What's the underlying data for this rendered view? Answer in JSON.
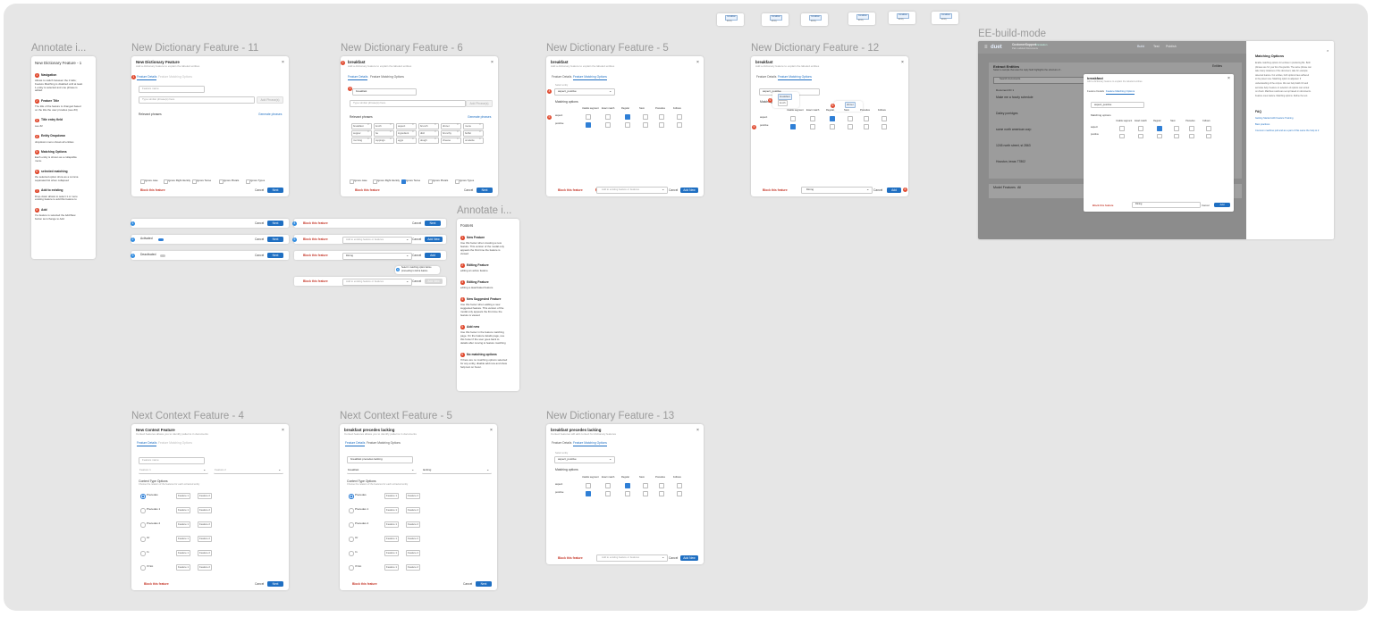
{
  "frame_titles": {
    "annotate1": "Annotate i...",
    "ndf11": "New Dictionary Feature - 11",
    "ndf6": "New Dictionary Feature - 6",
    "ndf5": "New Dictionary Feature - 5",
    "ndf12": "New Dictionary Feature - 12",
    "ee": "EE-build-mode",
    "annotate2": "Annotate i...",
    "ncf4": "Next Context Feature - 4",
    "ncf5": "Next Context Feature - 5",
    "ndf13": "New Dictionary Feature - 13"
  },
  "annotate1": {
    "heading": "New Dictionary Feature - 1",
    "items": [
      {
        "num": "1",
        "title": "Navigation",
        "body": [
          "Allows to switch between the 2 tabs;",
          "Feature Matching is disabled until at least",
          "1 entity is selected and one phrase is",
          "added."
        ]
      },
      {
        "num": "2",
        "title": "Feature Title",
        "body": [
          "The title of the feature is changed based",
          "on the title the user provides (see #3)"
        ]
      },
      {
        "num": "3",
        "title": "Title entry field",
        "body": [
          "see #2"
        ]
      },
      {
        "num": "4",
        "title": "Entity Dropdown",
        "body": [
          "dropdown menu shows all entities"
        ]
      },
      {
        "num": "5",
        "title": "Matching Options",
        "body": [
          "Each entity is shown as a collapsible",
          "menu."
        ]
      },
      {
        "num": "6",
        "title": "selected matching",
        "body": [
          "the selected option show as a comma",
          "separated list when collapsed"
        ]
      },
      {
        "num": "7",
        "title": "Add to existing",
        "body": [
          "Drop-down allows to select 1 or more",
          "existing feature to add this feature to"
        ]
      },
      {
        "num": "8",
        "title": "Add",
        "body": [
          "If a feature is selected the Add/New",
          "button text change to Add"
        ]
      }
    ]
  },
  "annotate2": {
    "heading": "Footers",
    "items": [
      {
        "num": "1",
        "title": "New Feature",
        "body": [
          "Use this footer when creating a new",
          "feature. This version of the modal only",
          "appears the first time the feature is",
          "viewed"
        ]
      },
      {
        "num": "2",
        "title": "Editing Feature",
        "body": [
          "editing an active feature"
        ]
      },
      {
        "num": "3",
        "title": "Editing Feature",
        "body": [
          "editing a deactivated feature"
        ]
      },
      {
        "num": "4",
        "title": "New Suggested Feature",
        "body": [
          "Use this footer when adding a new",
          "suggested feature. This version of the",
          "modal only appears the first time the",
          "feature is viewed"
        ]
      },
      {
        "num": "5",
        "title": "Add new",
        "body": [
          "Use this footer in the feature matching",
          "page. On the feature details page, use",
          "this footer if the user goes back to",
          "details after moving to feature matching"
        ]
      },
      {
        "num": "6",
        "title": "No matching options",
        "body": [
          "If there are no matching options selected",
          "for any entity, disable add new and show",
          "help text on hover."
        ]
      }
    ]
  },
  "modal_common": {
    "subtitle": "Add a dictionary feature to explain the labeled entities",
    "tab_details": "Feature Details",
    "tab_matching": "Feature Matching Options",
    "block": "Block this feature",
    "cancel": "Cancel",
    "next": "Next",
    "add_new": "Add New",
    "add": "Add",
    "add_existing_placeholder": "Add to existing feature or features",
    "existing_value": "Dining",
    "matching_header": "Matching options",
    "match_cols": [
      "Usable segment",
      "Exact match",
      "Regular",
      "Stem",
      "Precedes",
      "Follows"
    ],
    "entity_label": "Select entity",
    "entity_value": "aspect_positive",
    "row_labels": [
      "aspect",
      "positive"
    ],
    "relevant": "Relevant phrases",
    "generate": "Generate phrases",
    "phrase_placeholder": "Type similar phrase(s) here",
    "add_phrases": "Add Phrase(s)",
    "name_placeholder": "Feature name",
    "options": [
      "Ignore case",
      "Ignore Right Identity",
      "Ignore Tense",
      "Ignore Plurals",
      "Ignore Typos"
    ]
  },
  "ndf11": {
    "title": "New Dictionary Feature"
  },
  "ndf6": {
    "title": "breakfast",
    "name": "breakfast",
    "chips": [
      "breakfast",
      "lunch",
      "aspect",
      "brunch",
      "dinner",
      "menu",
      "supper",
      "be",
      "ingredient",
      "dish",
      "brunchy",
      "buffet",
      "morning",
      "toppings",
      "eggs",
      "dough",
      "cheese",
      "omelette"
    ]
  },
  "ndf5": {
    "title": "breakfast"
  },
  "ndf12": {
    "title": "breakfast",
    "popover1": "breakfast",
    "popover2": "lunch",
    "popover3": "dinner"
  },
  "ndf13": {
    "title": "breakfast precedes lacking",
    "subtitle": "Context features will add context for dictionary features"
  },
  "ncf4": {
    "title": "New Context Feature",
    "subtitle": "Context features allows you to identify patterns in documents",
    "name_placeholder": "Feature name",
    "sel1": "Feature 1",
    "sel2": "Feature 2",
    "context_header": "Context Type Options",
    "context_sub": "Choose the relation of the features for each extracted entity",
    "options": [
      "Precedes",
      "Precedes 1",
      "Precedes 2",
      "Or",
      "In",
      "If Not"
    ],
    "slots": [
      "Feature 1",
      "Feature 2"
    ]
  },
  "ncf5": {
    "title": "breakfast precedes lacking",
    "subtitle": "Context features allows you to identify patterns in documents",
    "name": "breakfast precedes lacking",
    "sel1": "breakfast",
    "sel2": "lacking"
  },
  "footers": {
    "activated": "Activated",
    "deactivated": "Deactivated",
    "tooltip": [
      "Select 1 matching option before",
      "proceeding to Add a feature"
    ]
  },
  "ee": {
    "logo": "duet",
    "project": "CustomerSupport",
    "project_status": "Annotation",
    "project_sub": "Pain Labeled Documents",
    "nav": [
      "Build",
      "Test",
      "Publish"
    ],
    "section1": "Extract Entities",
    "section1_sub": "Select a sample that was the reply field highlights the structure of...",
    "entities_label": "Entities",
    "search": "Search documents",
    "doc_label": "Document ID 1",
    "doc_lines": [
      "Make me a hourly schedule",
      "Dailey porridges",
      "some north american corp",
      "1245 north street, st 2863",
      "Houston, texas 77802"
    ],
    "model_features": "Model Features",
    "model_count": "All",
    "side_title": "Matching Options",
    "side_text": [
      "Enable matching options for entities in producing ML. Both",
      "phrases are for your list of keywords. The same phrase can",
      "take many instances of the document, take for example",
      "detected feature. For entities, both options have adhered",
      "to the parent one. Matching option is adjusted. If",
      "understanding of the corpus. We can help build rich and",
      "accurate help. Feature on selection of options can sorted",
      "on check. Matches results are set up based on documents.",
      "Feature ones feature. Matching options. Refine the text."
    ],
    "faq": "FAQ",
    "faq_links": [
      "Getting Started with Feature Training",
      "Best practices",
      "Common machine pull and as a part of this same the help to 2"
    ],
    "modal_title": "breakfast",
    "modal_sub": "Add a dictionary feature to explain the labeled entities",
    "modal_entity": "aspect_positive",
    "modal_existing": "Dining"
  },
  "minis": [
    {
      "tag": "Condition",
      "txt": "Entity"
    },
    {
      "tag": "Condition",
      "txt": "Entity"
    },
    {
      "tag": "Condition",
      "txt": "Entity"
    },
    {
      "tag": "Condition",
      "txt": "Entity"
    },
    {
      "tag": "Condition",
      "txt": "Entity"
    },
    {
      "tag": "Condition",
      "txt": "Entity"
    }
  ]
}
